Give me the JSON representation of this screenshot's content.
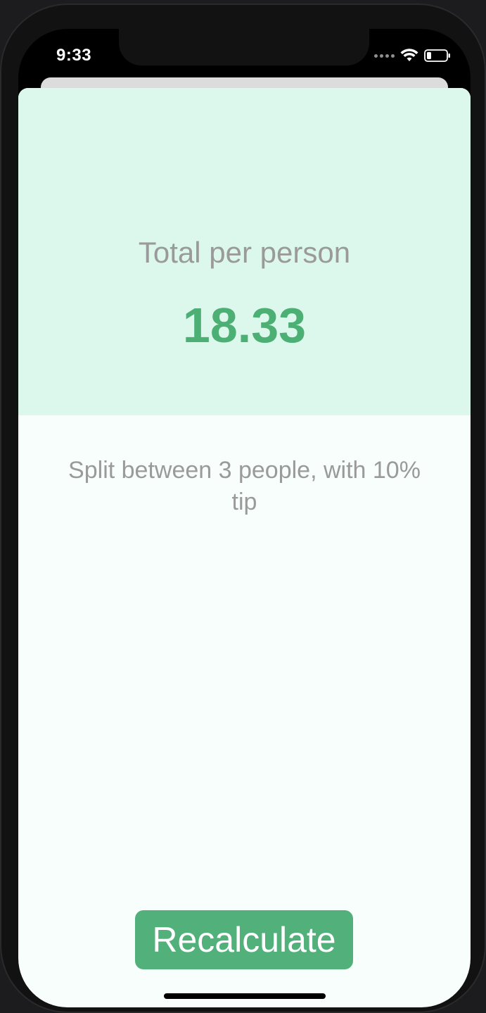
{
  "status_bar": {
    "time": "9:33",
    "icons": [
      "signal-dots-icon",
      "wifi-icon",
      "battery-icon"
    ]
  },
  "result": {
    "total_label": "Total per person",
    "total_value": "18.33",
    "settings_text": "Split between 3 people, with 10% tip"
  },
  "actions": {
    "recalculate_label": "Recalculate"
  },
  "colors": {
    "accent_green": "#4caf74",
    "top_panel_bg": "#dcf8ec",
    "bottom_bg": "#f7fefc",
    "button_bg": "#52b07a"
  }
}
